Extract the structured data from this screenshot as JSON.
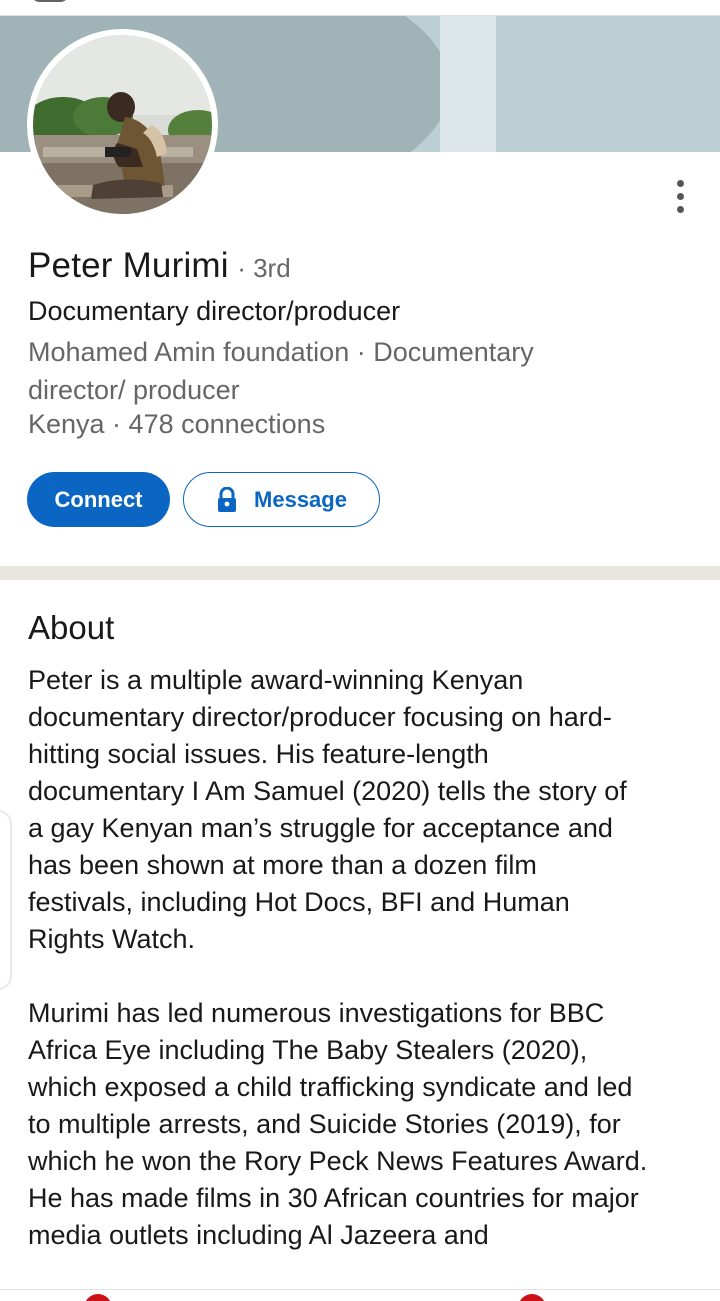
{
  "profile": {
    "name": "Peter Murimi",
    "degree": "· 3rd",
    "headline": "Documentary director/producer",
    "company": "Mohamed Amin foundation · Documentary director/ producer",
    "location": "Kenya · 478 connections"
  },
  "actions": {
    "connect_label": "Connect",
    "message_label": "Message"
  },
  "about": {
    "title": "About",
    "paragraphs": [
      "Peter is a multiple award-winning Kenyan documentary director/producer focusing on hard-hitting social issues. His feature-length documentary I Am Samuel (2020) tells the story of a gay Kenyan man’s struggle for acceptance and has been shown at more than a dozen film festivals, including Hot Docs, BFI and Human Rights Watch.",
      "Murimi has led numerous investigations for BBC Africa Eye including The Baby Stealers (2020), which exposed a child trafficking syndicate and led to multiple arrests, and Suicide Stories (2019), for which he won the Rory Peck News Features Award. He has made films in 30 African countries for major media outlets including Al Jazeera and"
    ]
  },
  "colors": {
    "accent": "#0a66c2",
    "banner": "#bccfd5",
    "divider": "#e9e5df",
    "badge": "#cc1016"
  },
  "icons": [
    "more-vertical-icon",
    "lock-icon"
  ]
}
